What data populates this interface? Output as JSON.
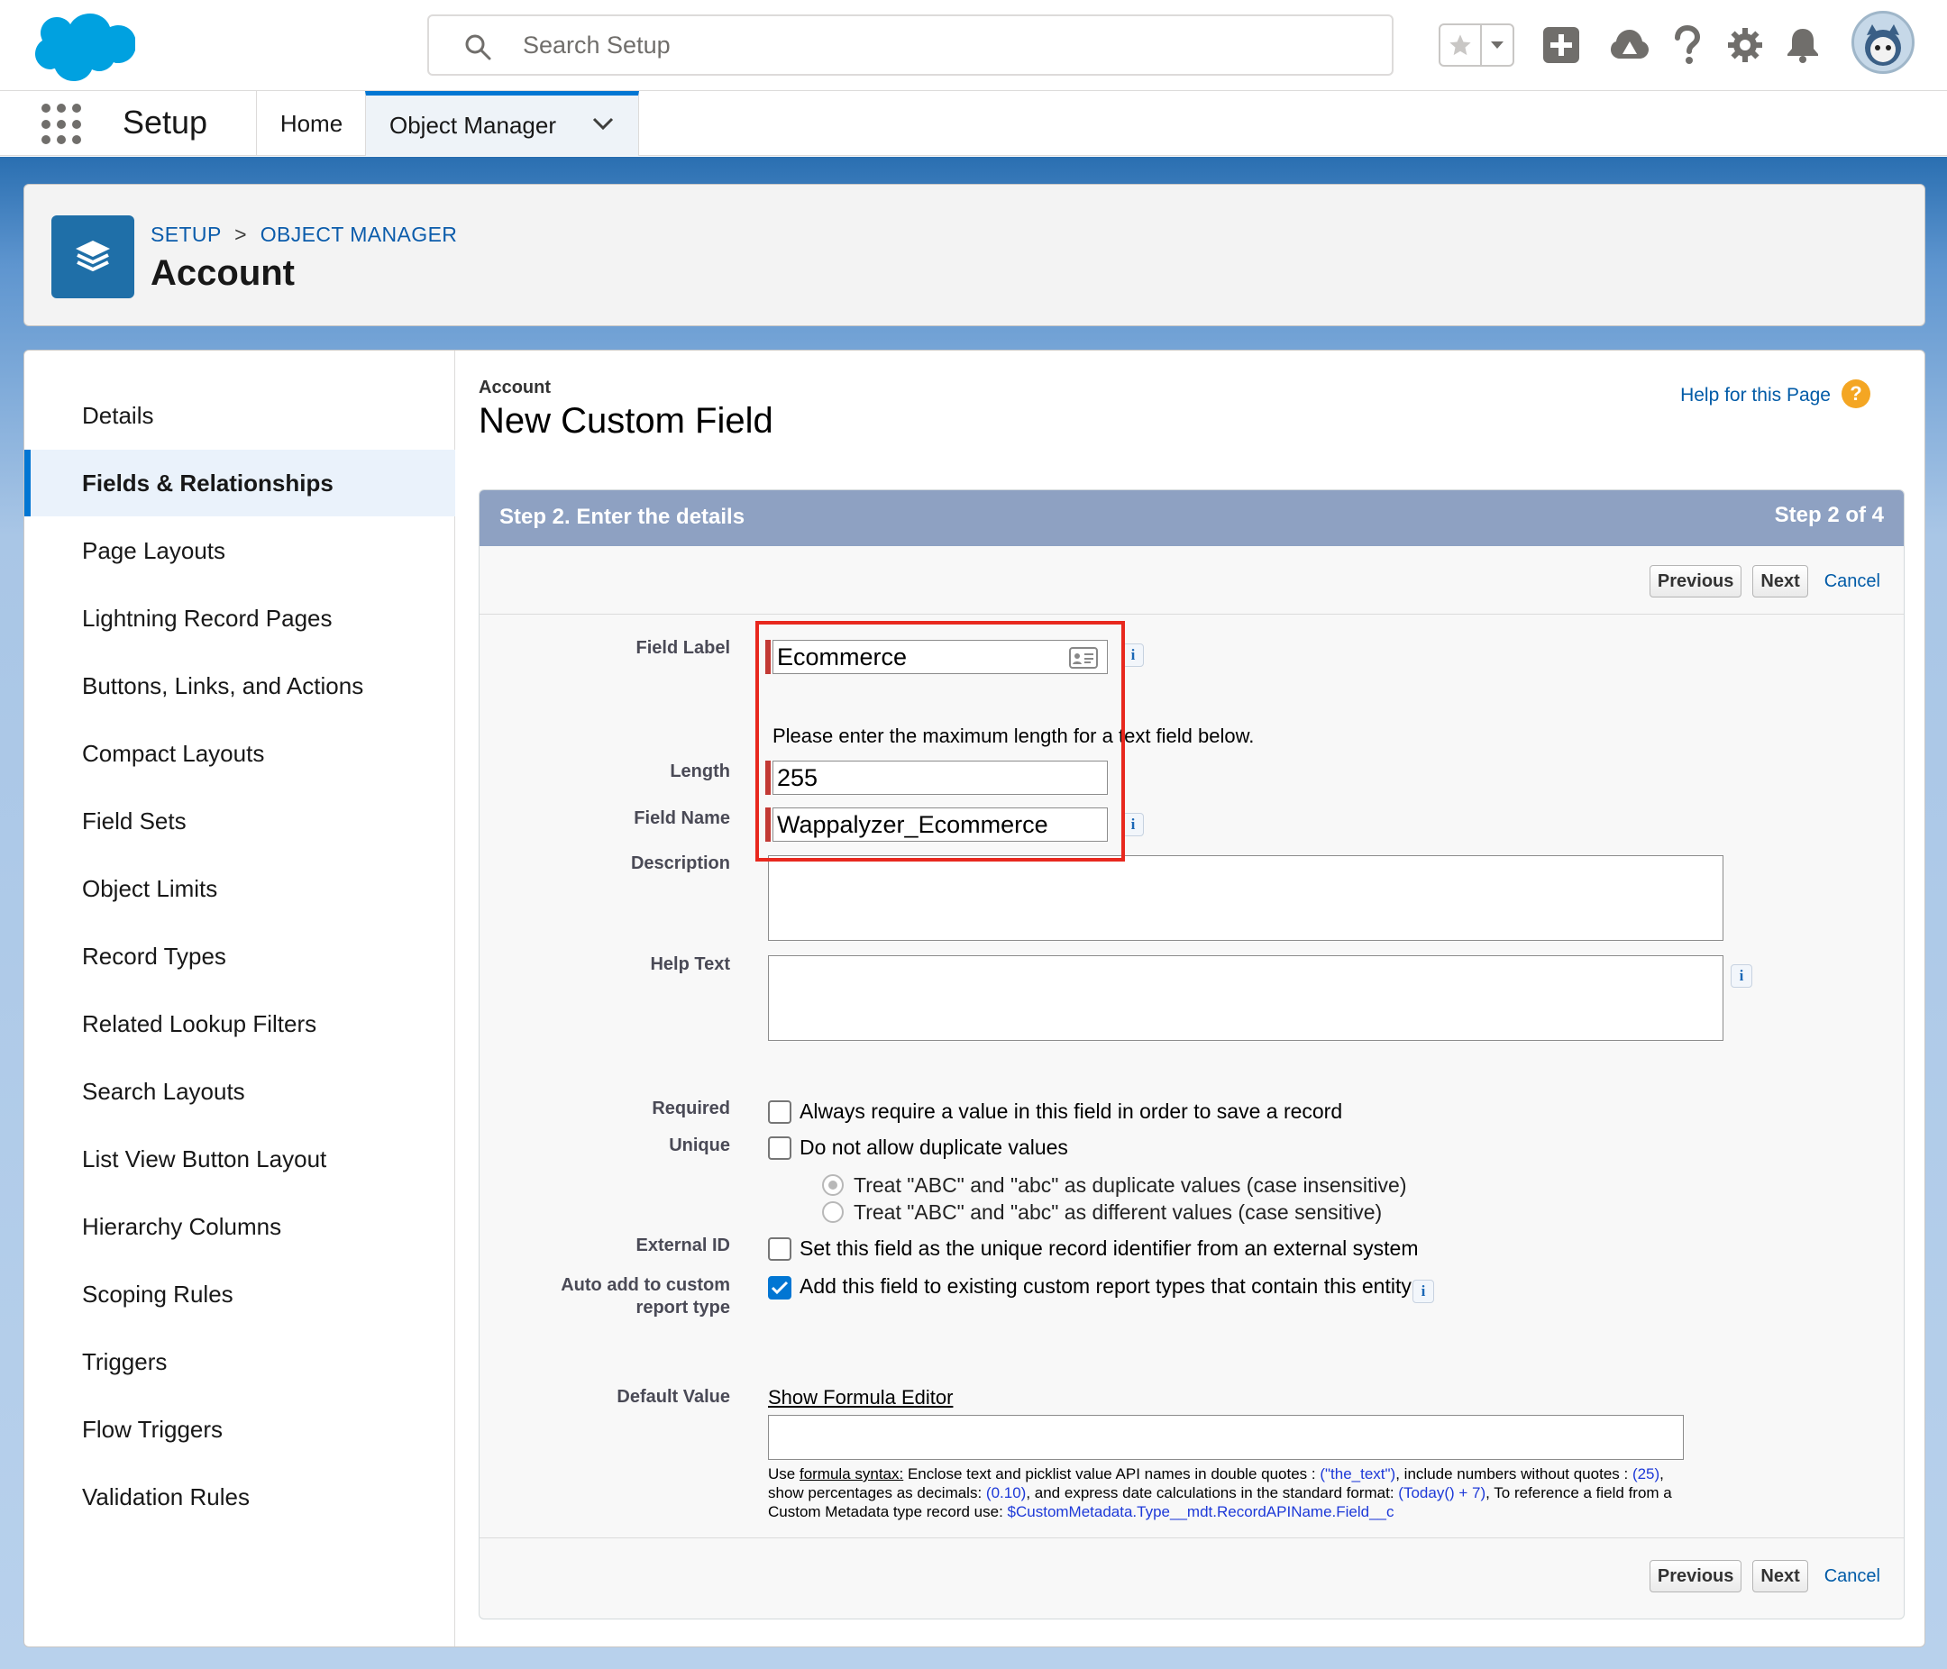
{
  "header": {
    "search_placeholder": "Search Setup",
    "icons": [
      "star-icon",
      "chevron-down-icon",
      "plus-icon",
      "trailhead-icon",
      "help-icon",
      "gear-icon",
      "bell-icon",
      "avatar"
    ]
  },
  "app_nav": {
    "app_name": "Setup",
    "tabs": [
      {
        "label": "Home"
      },
      {
        "label": "Object Manager"
      }
    ]
  },
  "object_header": {
    "breadcrumb": [
      "SETUP",
      ">",
      "OBJECT MANAGER"
    ],
    "title": "Account"
  },
  "sidebar": {
    "items": [
      {
        "label": "Details"
      },
      {
        "label": "Fields & Relationships",
        "active": true
      },
      {
        "label": "Page Layouts"
      },
      {
        "label": "Lightning Record Pages"
      },
      {
        "label": "Buttons, Links, and Actions"
      },
      {
        "label": "Compact Layouts"
      },
      {
        "label": "Field Sets"
      },
      {
        "label": "Object Limits"
      },
      {
        "label": "Record Types"
      },
      {
        "label": "Related Lookup Filters"
      },
      {
        "label": "Search Layouts"
      },
      {
        "label": "List View Button Layout"
      },
      {
        "label": "Hierarchy Columns"
      },
      {
        "label": "Scoping Rules"
      },
      {
        "label": "Triggers"
      },
      {
        "label": "Flow Triggers"
      },
      {
        "label": "Validation Rules"
      }
    ]
  },
  "page": {
    "object": "Account",
    "title": "New Custom Field",
    "help_link": "Help for this Page",
    "help_icon_glyph": "?"
  },
  "step": {
    "title": "Step 2. Enter the details",
    "count": "Step 2 of 4",
    "buttons": {
      "previous": "Previous",
      "next": "Next",
      "cancel": "Cancel"
    }
  },
  "form": {
    "field_label": {
      "label": "Field Label",
      "value": "Ecommerce"
    },
    "length_hint": "Please enter the maximum length for a text field below.",
    "length": {
      "label": "Length",
      "value": "255"
    },
    "field_name": {
      "label": "Field Name",
      "value": "Wappalyzer_Ecommerce"
    },
    "description": {
      "label": "Description",
      "value": ""
    },
    "help_text": {
      "label": "Help Text",
      "value": ""
    },
    "required": {
      "label": "Required",
      "text": "Always require a value in this field in order to save a record",
      "checked": false
    },
    "unique": {
      "label": "Unique",
      "text": "Do not allow duplicate values",
      "checked": false
    },
    "unique_options": [
      {
        "text": "Treat \"ABC\" and \"abc\" as duplicate values (case insensitive)",
        "selected": true
      },
      {
        "text": "Treat \"ABC\" and \"abc\" as different values (case sensitive)",
        "selected": false
      }
    ],
    "external_id": {
      "label": "External ID",
      "text": "Set this field as the unique record identifier from an external system",
      "checked": false
    },
    "auto_add": {
      "label_line1": "Auto add to custom",
      "label_line2": "report type",
      "text": "Add this field to existing custom report types that contain this entity",
      "checked": true
    },
    "default_value": {
      "label": "Default Value",
      "formula_link": "Show Formula Editor",
      "value": "",
      "syntax": {
        "p1": "Use ",
        "p2": "formula syntax:",
        "p3": " Enclose text and picklist value API names in double quotes : ",
        "p4": "(\"the_text\")",
        "p5": ", include numbers without quotes : ",
        "p6": "(25)",
        "p7": ", show percentages as decimals: ",
        "p8": "(0.10)",
        "p9": ", and express date calculations in the standard format: ",
        "p10": "(Today() + 7)",
        "p11": ", To reference a field from a Custom Metadata type record use: ",
        "p12": "$CustomMetadata.Type__mdt.RecordAPIName.Field__c"
      }
    },
    "info_glyph": "i"
  },
  "colors": {
    "brand_blue": "#0176d3",
    "step_bar": "#8ea1c2",
    "required_bar": "#c23934",
    "highlight": "#e8281e"
  }
}
